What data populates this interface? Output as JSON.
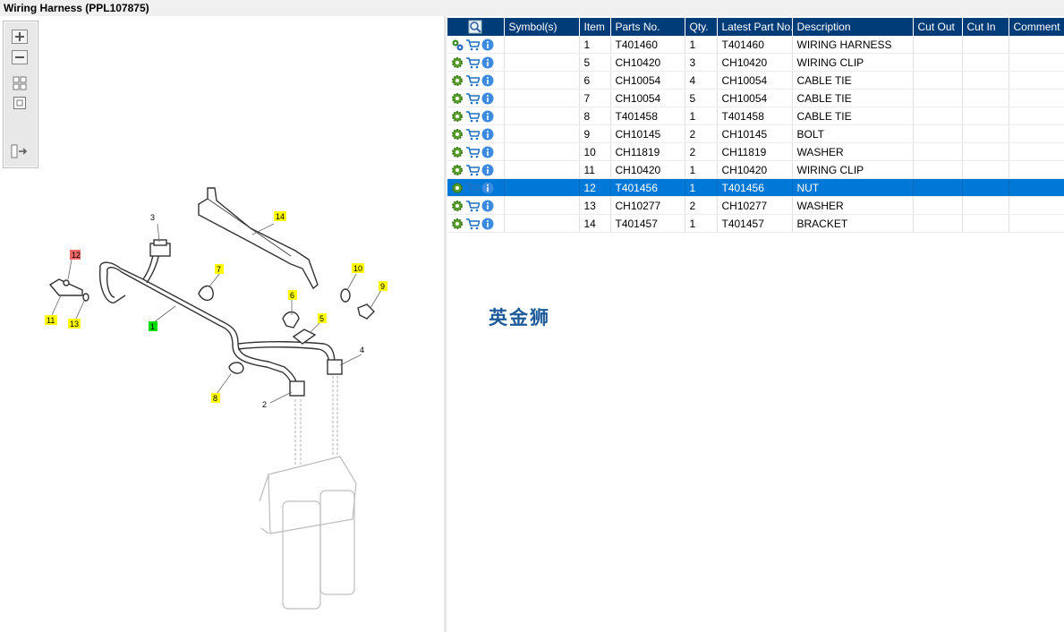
{
  "window": {
    "title": "Wiring Harness (PPL107875)"
  },
  "toolbar": {
    "icons": [
      "zoom-in-icon",
      "zoom-out-icon",
      "fit-all-icon",
      "actual-size-icon",
      "layout-toggle-icon"
    ]
  },
  "diagram": {
    "callouts": [
      {
        "label": "3",
        "highlight": "none"
      },
      {
        "label": "14",
        "highlight": "yellow"
      },
      {
        "label": "12",
        "highlight": "red"
      },
      {
        "label": "7",
        "highlight": "yellow"
      },
      {
        "label": "10",
        "highlight": "yellow"
      },
      {
        "label": "9",
        "highlight": "yellow"
      },
      {
        "label": "11",
        "highlight": "yellow"
      },
      {
        "label": "13",
        "highlight": "yellow"
      },
      {
        "label": "1",
        "highlight": "green"
      },
      {
        "label": "6",
        "highlight": "yellow"
      },
      {
        "label": "5",
        "highlight": "yellow"
      },
      {
        "label": "4",
        "highlight": "none"
      },
      {
        "label": "8",
        "highlight": "yellow"
      },
      {
        "label": "2",
        "highlight": "none"
      }
    ]
  },
  "table": {
    "columns": [
      "",
      "Symbol(s)",
      "Item",
      "Parts No.",
      "Qty.",
      "Latest Part No.",
      "Description",
      "Cut Out",
      "Cut In",
      "Comment"
    ],
    "rows": [
      {
        "item": "1",
        "part_no": "T401460",
        "qty": "1",
        "latest": "T401460",
        "desc": "WIRING HARNESS",
        "selected": false,
        "icon": "assembly-icon"
      },
      {
        "item": "5",
        "part_no": "CH10420",
        "qty": "3",
        "latest": "CH10420",
        "desc": "WIRING CLIP",
        "selected": false,
        "icon": "gear-icon"
      },
      {
        "item": "6",
        "part_no": "CH10054",
        "qty": "4",
        "latest": "CH10054",
        "desc": "CABLE TIE",
        "selected": false,
        "icon": "gear-icon"
      },
      {
        "item": "7",
        "part_no": "CH10054",
        "qty": "5",
        "latest": "CH10054",
        "desc": "CABLE TIE",
        "selected": false,
        "icon": "gear-icon"
      },
      {
        "item": "8",
        "part_no": "T401458",
        "qty": "1",
        "latest": "T401458",
        "desc": "CABLE TIE",
        "selected": false,
        "icon": "gear-icon"
      },
      {
        "item": "9",
        "part_no": "CH10145",
        "qty": "2",
        "latest": "CH10145",
        "desc": "BOLT",
        "selected": false,
        "icon": "gear-icon"
      },
      {
        "item": "10",
        "part_no": "CH11819",
        "qty": "2",
        "latest": "CH11819",
        "desc": "WASHER",
        "selected": false,
        "icon": "gear-icon"
      },
      {
        "item": "11",
        "part_no": "CH10420",
        "qty": "1",
        "latest": "CH10420",
        "desc": "WIRING CLIP",
        "selected": false,
        "icon": "gear-icon"
      },
      {
        "item": "12",
        "part_no": "T401456",
        "qty": "1",
        "latest": "T401456",
        "desc": "NUT",
        "selected": true,
        "icon": "gear-icon"
      },
      {
        "item": "13",
        "part_no": "CH10277",
        "qty": "2",
        "latest": "CH10277",
        "desc": "WASHER",
        "selected": false,
        "icon": "gear-icon"
      },
      {
        "item": "14",
        "part_no": "T401457",
        "qty": "1",
        "latest": "T401457",
        "desc": "BRACKET",
        "selected": false,
        "icon": "gear-icon"
      }
    ]
  },
  "watermark": {
    "text": "英金狮"
  },
  "colors": {
    "header": "#003c78",
    "selected": "#0078d7",
    "callout_yellow": "#ffff00",
    "callout_red": "#ee6666",
    "callout_green": "#00dd00"
  }
}
